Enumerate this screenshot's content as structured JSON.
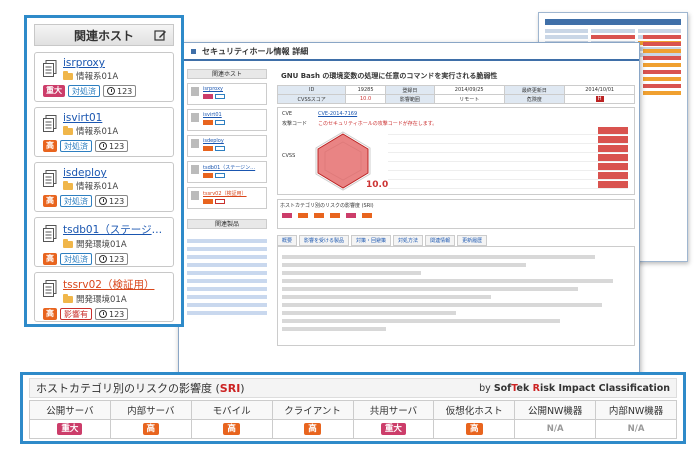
{
  "host_panel": {
    "title": "関連ホスト",
    "hosts": [
      {
        "name": "isrproxy",
        "env": "情報系01A",
        "severity": "重大",
        "severity_level": "critical",
        "status": "対処済",
        "count": "123"
      },
      {
        "name": "isvirt01",
        "env": "情報系01A",
        "severity": "高",
        "severity_level": "high",
        "status": "対処済",
        "count": "123"
      },
      {
        "name": "isdeploy",
        "env": "情報系01A",
        "severity": "高",
        "severity_level": "high",
        "status": "対処済",
        "count": "123"
      },
      {
        "name": "tsdb01（ステージン…",
        "env": "開発環境01A",
        "severity": "高",
        "severity_level": "high",
        "status": "対処済",
        "count": "123"
      },
      {
        "name": "tssrv02（検証用）",
        "env": "開発環境01A",
        "severity": "高",
        "severity_level": "high",
        "status": "影響有",
        "count": "123"
      }
    ]
  },
  "middle": {
    "page_title": "セキュリティホール情報 詳細",
    "side_header": "関連ホスト",
    "products_header": "関連製品",
    "vuln_title": "GNU Bash の環境変数の処理に任意のコマンドを実行される脆弱性",
    "table": {
      "row1": [
        "ID",
        "19285",
        "登録日",
        "2014/09/25",
        "最終更新日",
        "2014/10/01"
      ],
      "row2": [
        "CVSSスコア",
        "10.0",
        "影響範囲",
        "リモート",
        "危険度",
        "H"
      ]
    },
    "cve_label": "CVE",
    "cve_value": "CVE-2014-7169",
    "attack_label": "攻撃コード",
    "attack_text": "このセキュリティホールの攻撃コードが存在します。",
    "cvss_label": "CVSS",
    "cvss_score": "10.0",
    "sri_label": "ホストカテゴリ別のリスクの影響度 (SRI)",
    "tabs": [
      "概要",
      "影響を受ける製品",
      "対策・回避策",
      "対処方法",
      "関連情報",
      "更新履歴"
    ]
  },
  "sri": {
    "title_prefix": "ホストカテゴリ別のリスクの影響度 (",
    "title_acronym": "SRI",
    "title_suffix": ")",
    "by_prefix": "by ",
    "by_sof": "Sof",
    "by_t": "T",
    "by_ek": "ek ",
    "by_r": "R",
    "by_isk": "isk Impact Classification",
    "categories": [
      "公開サーバ",
      "内部サーバ",
      "モバイル",
      "クライアント",
      "共用サーバ",
      "仮想化ホスト",
      "公開NW機器",
      "内部NW機器"
    ],
    "levels": [
      "重大",
      "高",
      "高",
      "高",
      "重大",
      "高",
      "N/A",
      "N/A"
    ],
    "level_kinds": [
      "critical",
      "high",
      "high",
      "high",
      "critical",
      "high",
      "na",
      "na"
    ],
    "colors": {
      "critical": "#cc3d6a",
      "high": "#e8641e",
      "frame": "#2e8ac9"
    }
  }
}
